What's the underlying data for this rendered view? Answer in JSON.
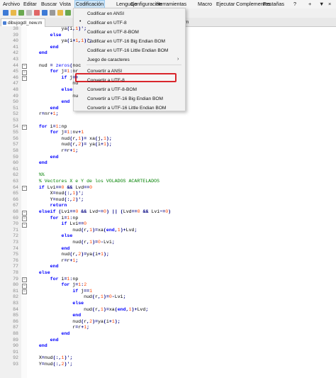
{
  "menubar": [
    "Archivo",
    "Editar",
    "Buscar",
    "Vista",
    "Codificación",
    "Lenguaje",
    "Configuración",
    "Herramientas",
    "Macro",
    "Ejecutar",
    "Complementos",
    "Pestañas",
    "?"
  ],
  "window_controls": [
    "+",
    "▼",
    "×"
  ],
  "tab": {
    "label": "dibujogdl_new.m"
  },
  "tab_tail": "m",
  "encoding_menu": {
    "items": [
      {
        "label": "Codificar en ANSI"
      },
      {
        "label": "Codificar en UTF-8",
        "checked": true
      },
      {
        "label": "Codificar en UTF-8-BOM"
      },
      {
        "label": "Codificar en UTF-16 Big Endian BOM"
      },
      {
        "label": "Codificar en UTF-16 Little Endian BOM"
      },
      {
        "label": "Juego de caracteres",
        "submenu": true
      },
      {
        "label": "Convertir a ANSI"
      },
      {
        "label": "Convertir a UTF-8",
        "highlighted": true
      },
      {
        "label": "Convertir a UTF-8-BOM"
      },
      {
        "label": "Convertir a UTF-16 Big Endian BOM"
      },
      {
        "label": "Convertir a UTF-16 Little Endian BOM"
      }
    ]
  },
  "highlight_color": "#d9262c",
  "code": {
    "lines": [
      {
        "n": "38",
        "t": "            ya(i,1)';"
      },
      {
        "n": "39",
        "t": "        else"
      },
      {
        "n": "40",
        "t": "            ya(i+1,1)';"
      },
      {
        "n": "41",
        "t": "        end"
      },
      {
        "n": "42",
        "t": "    end"
      },
      {
        "n": "43",
        "t": ""
      },
      {
        "n": "44",
        "t": "    nud = zeros(noc"
      },
      {
        "n": "45",
        "t": "        for j=1:nr"
      },
      {
        "n": "46",
        "t": "            if j=="
      },
      {
        "n": "47",
        "t": "                nu"
      },
      {
        "n": "48",
        "t": "            else"
      },
      {
        "n": "49",
        "t": "                nu"
      },
      {
        "n": "50",
        "t": "            end"
      },
      {
        "n": "51",
        "t": "        end"
      },
      {
        "n": "52",
        "t": "    r=nr+1;"
      },
      {
        "n": "53",
        "t": ""
      },
      {
        "n": "54",
        "t": "    for i=1:np"
      },
      {
        "n": "55",
        "t": "        for j=1:nv+1"
      },
      {
        "n": "56",
        "t": "            nud(r,1)= xa(j,1);"
      },
      {
        "n": "57",
        "t": "            nud(r,2)= ya(i+1);"
      },
      {
        "n": "58",
        "t": "            r=r+1;"
      },
      {
        "n": "59",
        "t": "        end"
      },
      {
        "n": "60",
        "t": "    end"
      },
      {
        "n": "61",
        "t": ""
      },
      {
        "n": "62",
        "t": "    %%"
      },
      {
        "n": "63",
        "t": "    % Vectores X e Y de los VOLADOS ACARTELADOS"
      },
      {
        "n": "64",
        "t": "    if Lvi==0 && Lvd==0"
      },
      {
        "n": "65",
        "t": "        X=nud(:,1)';"
      },
      {
        "n": "66",
        "t": "        Y=nud(:,2)';"
      },
      {
        "n": "67",
        "t": "        return"
      },
      {
        "n": "68",
        "t": "    elseif (Lvi==0 && Lvd~=0) || (Lvd==0 && Lvi~=0)"
      },
      {
        "n": "69",
        "t": "        for i=1:np"
      },
      {
        "n": "70",
        "t": "            if Lvi==0"
      },
      {
        "n": "71",
        "t": "                nud(r,1)=xa(end,1)+Lvd;"
      },
      {
        "n": "72",
        "t": "            else"
      },
      {
        "n": "73",
        "t": "                nud(r,1)=0-Lvi;"
      },
      {
        "n": "74",
        "t": "            end"
      },
      {
        "n": "75",
        "t": "            nud(r,2)=ya(i+1);"
      },
      {
        "n": "76",
        "t": "            r=r+1;"
      },
      {
        "n": "77",
        "t": "        end"
      },
      {
        "n": "78",
        "t": "    else"
      },
      {
        "n": "79",
        "t": "        for i=1:np"
      },
      {
        "n": "80",
        "t": "            for j=1:2"
      },
      {
        "n": "81",
        "t": "                if j==1"
      },
      {
        "n": "82",
        "t": "                    nud(r,1)=0-Lvi;"
      },
      {
        "n": "83",
        "t": "                else"
      },
      {
        "n": "84",
        "t": "                    nud(r,1)=xa(end,1)+Lvd;"
      },
      {
        "n": "85",
        "t": "                end"
      },
      {
        "n": "86",
        "t": "                nud(r,2)=ya(i+1);"
      },
      {
        "n": "87",
        "t": "                r=r+1;"
      },
      {
        "n": "88",
        "t": "            end"
      },
      {
        "n": "89",
        "t": "        end"
      },
      {
        "n": "90",
        "t": "    end"
      },
      {
        "n": "91",
        "t": ""
      },
      {
        "n": "92",
        "t": "    X=nud(:,1)';"
      },
      {
        "n": "93",
        "t": "    Y=nud(:,2)';"
      }
    ]
  }
}
